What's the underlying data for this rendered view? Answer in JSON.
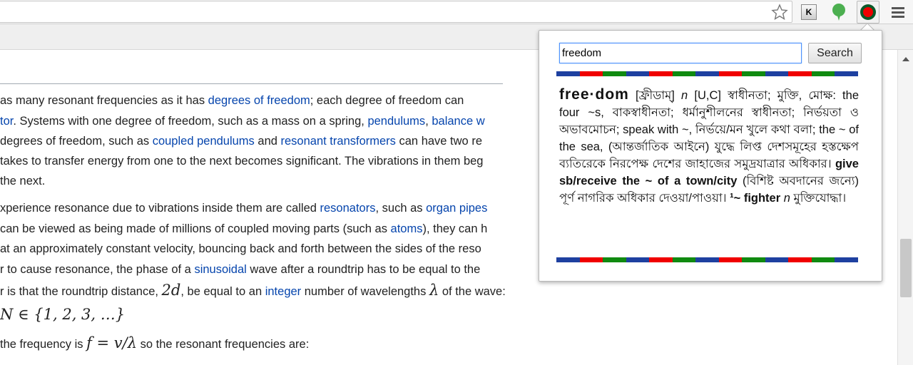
{
  "browser": {
    "icons": [
      "star-icon",
      "k-extension-icon",
      "green-balloon-icon",
      "red-dot-dictionary-icon",
      "menu-icon"
    ]
  },
  "article": {
    "lines": [
      [
        {
          "t": "as many resonant frequencies as it has "
        },
        {
          "t": "degrees of freedom",
          "l": 1
        },
        {
          "t": "; each degree of freedom can"
        }
      ],
      [
        {
          "t": "tor",
          "l": 1
        },
        {
          "t": ". Systems with one degree of freedom, such as a mass on a spring, "
        },
        {
          "t": "pendulums",
          "l": 1
        },
        {
          "t": ", "
        },
        {
          "t": "balance w",
          "l": 1
        }
      ],
      [
        {
          "t": " degrees of freedom, such as "
        },
        {
          "t": "coupled pendulums",
          "l": 1
        },
        {
          "t": " and "
        },
        {
          "t": "resonant transformers",
          "l": 1
        },
        {
          "t": " can have two re"
        }
      ],
      [
        {
          "t": "takes to transfer energy from one to the next becomes significant. The vibrations in them beg"
        }
      ],
      [
        {
          "t": " the next."
        }
      ],
      [
        {
          "t": "xperience resonance due to vibrations inside them are called "
        },
        {
          "t": "resonators",
          "l": 1
        },
        {
          "t": ", such as "
        },
        {
          "t": "organ pipes",
          "l": 1
        }
      ],
      [
        {
          "t": "can be viewed as being made of millions of coupled moving parts (such as "
        },
        {
          "t": "atoms",
          "l": 1
        },
        {
          "t": "), they can h"
        }
      ],
      [
        {
          "t": " at an approximately constant velocity, bouncing back and forth between the sides of the reso"
        }
      ],
      [
        {
          "t": "r to cause resonance, the phase of a "
        },
        {
          "t": "sinusoidal",
          "l": 1
        },
        {
          "t": " wave after a roundtrip has to be equal to the"
        }
      ],
      [
        {
          "t": "r is that the roundtrip distance, "
        },
        {
          "t": "2d",
          "m": 1
        },
        {
          "t": ", be equal to an "
        },
        {
          "t": "integer",
          "l": 1
        },
        {
          "t": " number of wavelengths "
        },
        {
          "t": "λ",
          "m": 1
        },
        {
          "t": " of the wave:"
        }
      ],
      [
        {
          "t": "  "
        },
        {
          "t": "N ∈ {1, 2, 3, …}",
          "m": 1
        }
      ],
      [
        {
          "t": " the frequency is "
        },
        {
          "t": "f = v/λ",
          "m": 1
        },
        {
          "t": " so the resonant frequencies are:"
        }
      ]
    ]
  },
  "popup": {
    "search_value": "freedom",
    "search_label": "Search",
    "stripe_colors": [
      "#1e40a0",
      "#f00000",
      "#108a10"
    ],
    "entry": {
      "headword": "free·dom",
      "pron": "[ফ্রীডাম্]",
      "pos": "n",
      "grammar": "[U,C]",
      "body": "স্বাধীনতা; মুক্তি, মোক্ষ: the four ~s, বাকস্বাধীনতা; ধর্মানুশীলনের স্বাধীনতা; নির্ভয়তা ও অভাবমোচন; speak with ~, নির্ভয়ে/মন খুলে কথা বলা; the ~ of the sea, (আন্তর্জাতিক আইনে) যুদ্ধে লিপ্ত দেশসমূহের হস্তক্ষেপ ব্যতিরেকে নিরপেক্ষ দেশের জাহাজের সমুদ্রযাত্রার অধিকার।",
      "phrase": "give sb/receive the ~ of a town/city",
      "phrase_def": "(বিশিষ্ট অবদানের জন্যে) পূর্ণ নাগরিক অধিকার দেওয়া/পাওয়া।",
      "compound": "¹~ fighter",
      "compound_pos": "n",
      "compound_def": "মুক্তিযোদ্ধা।"
    }
  }
}
